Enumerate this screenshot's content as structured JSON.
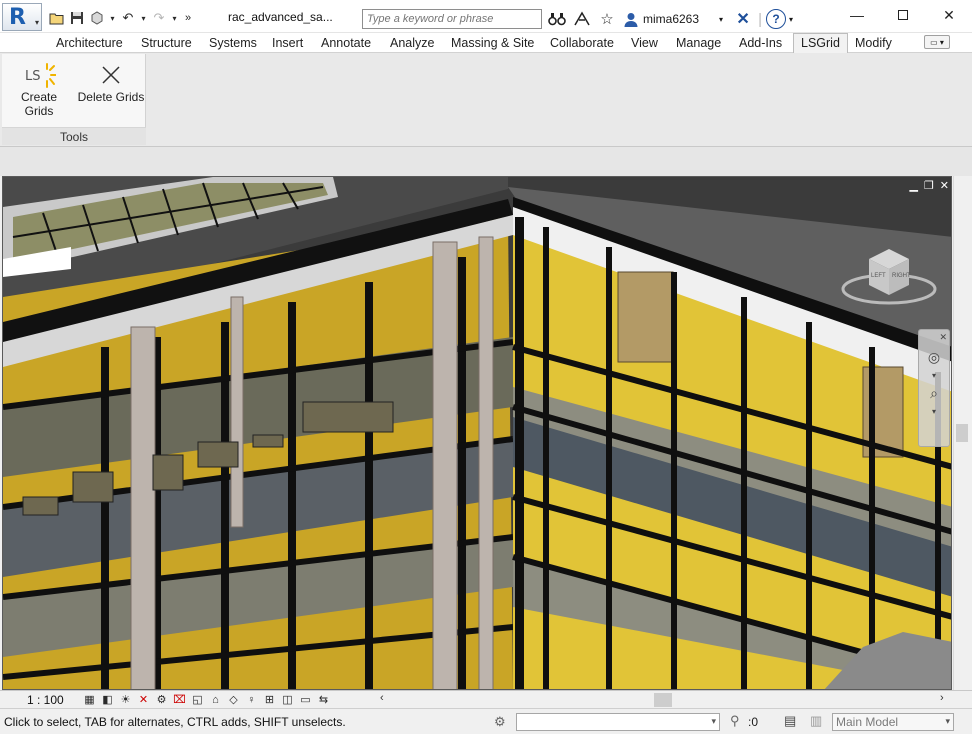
{
  "titlebar": {
    "app_letter": "R",
    "document_title": "rac_advanced_sa...",
    "search_placeholder": "Type a keyword or phrase",
    "username": "mima6263",
    "help_label": "?"
  },
  "tabs": [
    "Architecture",
    "Structure",
    "Systems",
    "Insert",
    "Annotate",
    "Analyze",
    "Massing & Site",
    "Collaborate",
    "View",
    "Manage",
    "Add-Ins",
    "LSGrid",
    "Modify"
  ],
  "active_tab": "LSGrid",
  "ribbon": {
    "panel_label": "Tools",
    "create_grids_label": "Create Grids",
    "create_grids_icon_text": "LS",
    "delete_grids_label": "Delete Grids"
  },
  "viewcube": {
    "left_face": "LEFT",
    "right_face": "RIGHT"
  },
  "viewbar": {
    "scale": "1 : 100"
  },
  "statusbar": {
    "message": "Click to select, TAB for alternates, CTRL adds, SHIFT unselects.",
    "filter_count": ":0",
    "model_placeholder": "Main Model"
  },
  "colors": {
    "ribbon_bg": "#e9e9e9",
    "wall_yellow": "#d9b52a",
    "mullion": "#0e0e0e",
    "glass_blue": "#4d5a66"
  },
  "icons": [
    "open-icon",
    "save-icon",
    "sync-icon",
    "undo-icon",
    "redo-icon",
    "search-icon",
    "binoculars-icon",
    "star-icon",
    "user-icon",
    "autodesk-exchange-icon",
    "help-icon",
    "minimize-icon",
    "maximize-icon",
    "close-icon",
    "create-grids-icon",
    "delete-grids-icon"
  ]
}
